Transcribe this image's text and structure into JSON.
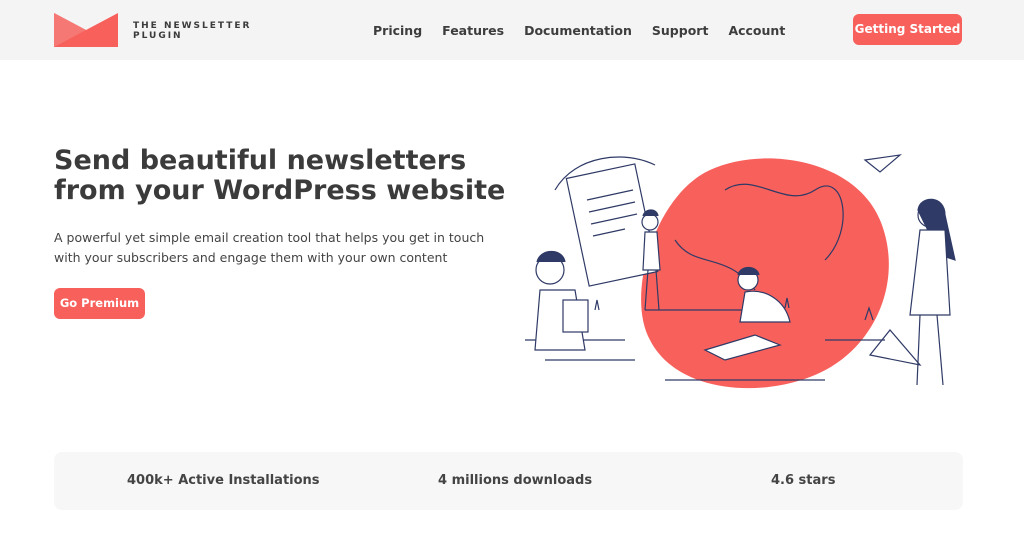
{
  "brand": {
    "name_line1": "THE NEWSLETTER",
    "name_line2": "PLUGIN",
    "accent": "#f8605c"
  },
  "nav": {
    "items": [
      "Pricing",
      "Features",
      "Documentation",
      "Support",
      "Account"
    ]
  },
  "header": {
    "cta_label": "Getting Started"
  },
  "hero": {
    "title": "Send beautiful newsletters from your WordPress website",
    "subtitle": "A powerful yet simple email creation tool that helps you get in touch with your subscribers and engage them with your own content",
    "button_label": "Go Premium"
  },
  "stats": [
    {
      "label": "400k+ Active Installations"
    },
    {
      "label": "4 millions downloads"
    },
    {
      "label": "4.6 stars"
    }
  ]
}
